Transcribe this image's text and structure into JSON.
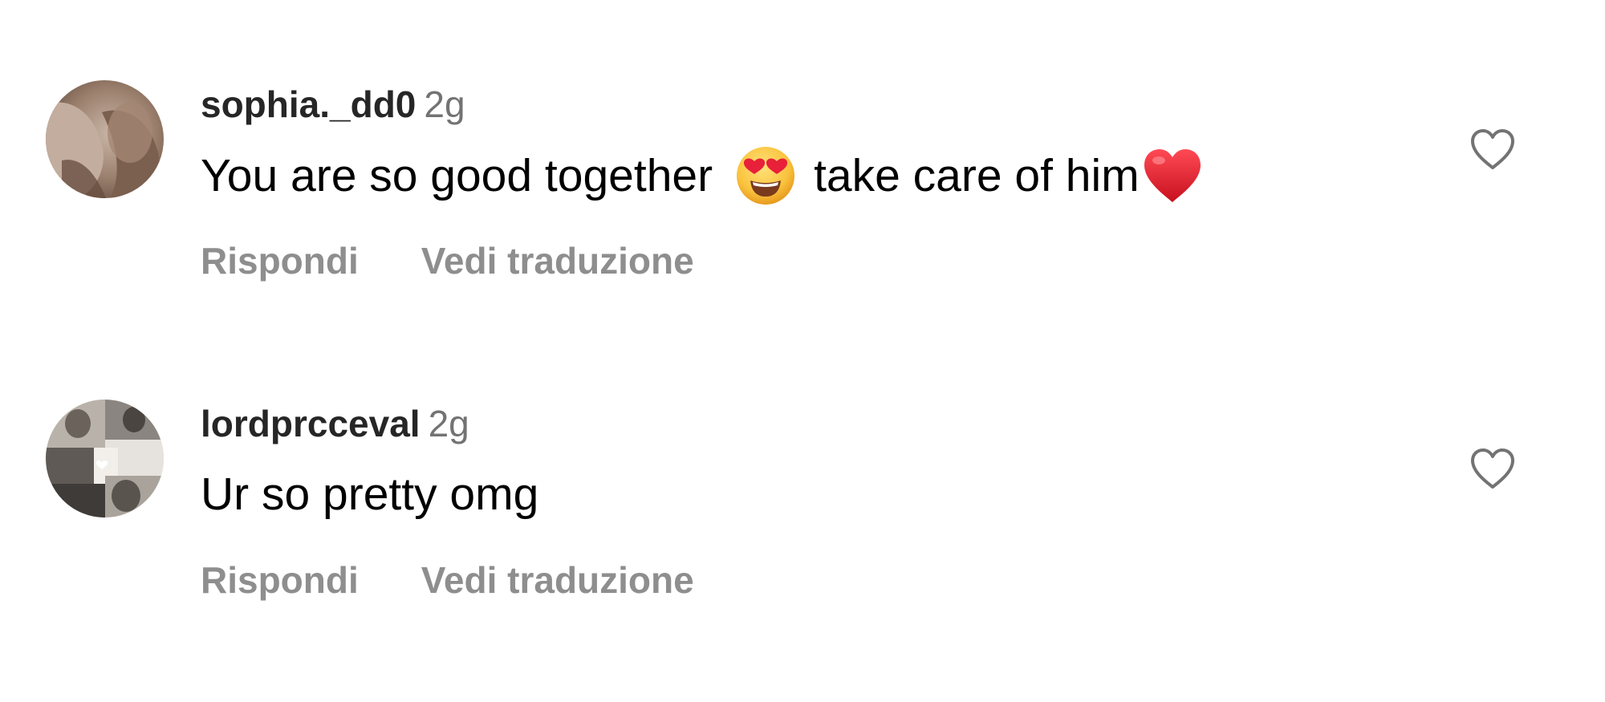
{
  "comments": [
    {
      "username": "sophia._dd0",
      "time": "2g",
      "text_before_emoji": "You are so good together",
      "text_after_emoji": "take care of him",
      "inline_emojis": [
        "heart-eyes-emoji",
        "red-heart-emoji"
      ],
      "reply_label": "Rispondi",
      "translate_label": "Vedi traduzione",
      "like_icon": "heart-outline-icon"
    },
    {
      "username": "lordprcceval",
      "time": "2g",
      "text": "Ur so pretty omg",
      "reply_label": "Rispondi",
      "translate_label": "Vedi traduzione",
      "like_icon": "heart-outline-icon"
    }
  ],
  "colors": {
    "username": "#262626",
    "time": "#737373",
    "action_text": "#8e8e8e",
    "like_icon_stroke": "#737373",
    "heart_emoji": "#e3202f",
    "face_emoji": "#f9c23c"
  }
}
